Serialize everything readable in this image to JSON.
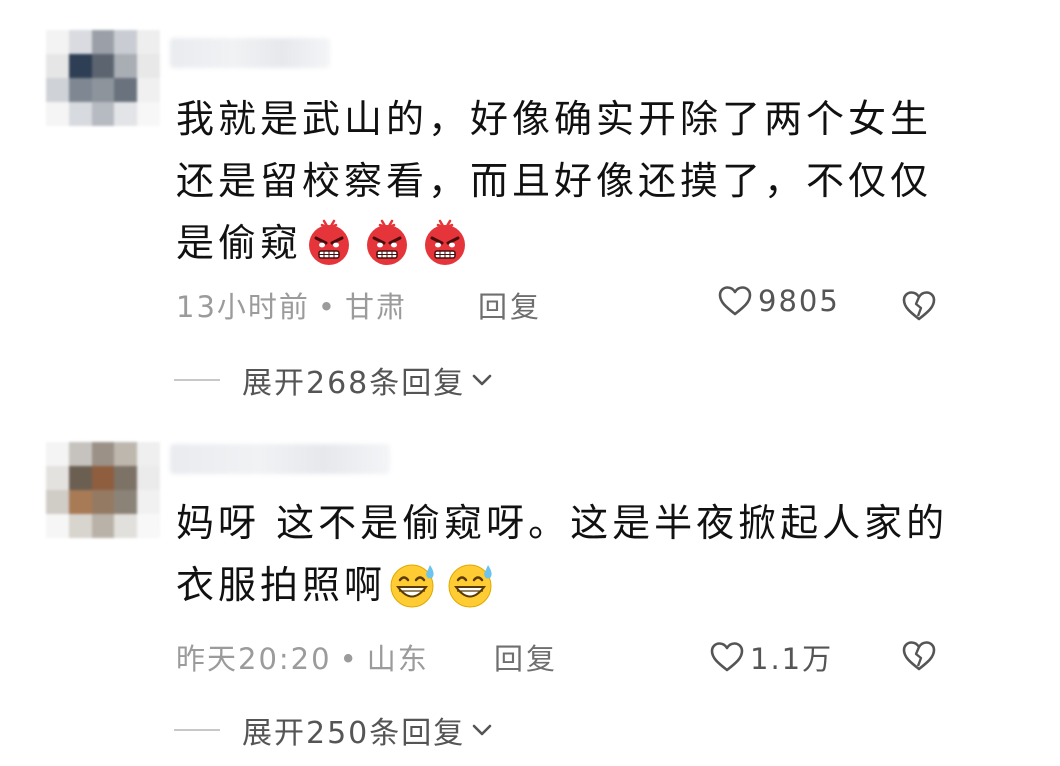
{
  "comments": [
    {
      "avatar_colors": [
        "#f3f3f3",
        "#d9dbe0",
        "#9ba0a8",
        "#c9cdd3",
        "#eeeeee",
        "#e6e6e6",
        "#2e3e55",
        "#5c6470",
        "#a9adb4",
        "#e8e8e8",
        "#cfd2d7",
        "#7f8793",
        "#8e949c",
        "#6a727d",
        "#f0f0f0",
        "#f5f5f5",
        "#d7dadf",
        "#b6bac1",
        "#e3e4e7",
        "#f7f7f7"
      ],
      "lines": [
        "我就是武山的，好像确实开除了两个女生",
        "还是留校察看，而且好像还摸了，不仅仅",
        "是偷窥"
      ],
      "emoji_name": "angry-face-emoji",
      "emoji_count": 3,
      "time": "13小时前",
      "location": "甘肃",
      "reply_label": "回复",
      "likes": "9805",
      "expand_label": "展开268条回复"
    },
    {
      "avatar_colors": [
        "#f4f4f4",
        "#c6c3be",
        "#9b9187",
        "#bdb7ae",
        "#efefef",
        "#e4e2df",
        "#6b5f52",
        "#8f5e3f",
        "#7d7266",
        "#ebebeb",
        "#d0ccc6",
        "#a87a56",
        "#957a63",
        "#8b8378",
        "#f1f1f1",
        "#f6f6f6",
        "#d8d4ce",
        "#b9b2a8",
        "#e2e0dc",
        "#f8f8f8"
      ],
      "lines": [
        "妈呀 这不是偷窥呀。这是半夜掀起人家的",
        "衣服拍照啊"
      ],
      "emoji_name": "grinning-sweat-emoji",
      "emoji_count": 2,
      "time": "昨天20:20",
      "location": "山东",
      "reply_label": "回复",
      "likes": "1.1万",
      "expand_label": "展开250条回复"
    }
  ],
  "dot": "•",
  "colors": {
    "angry_red": "#e5343a",
    "grin_yellow": "#ffcc33",
    "sweat_blue": "#6cc3ee"
  }
}
